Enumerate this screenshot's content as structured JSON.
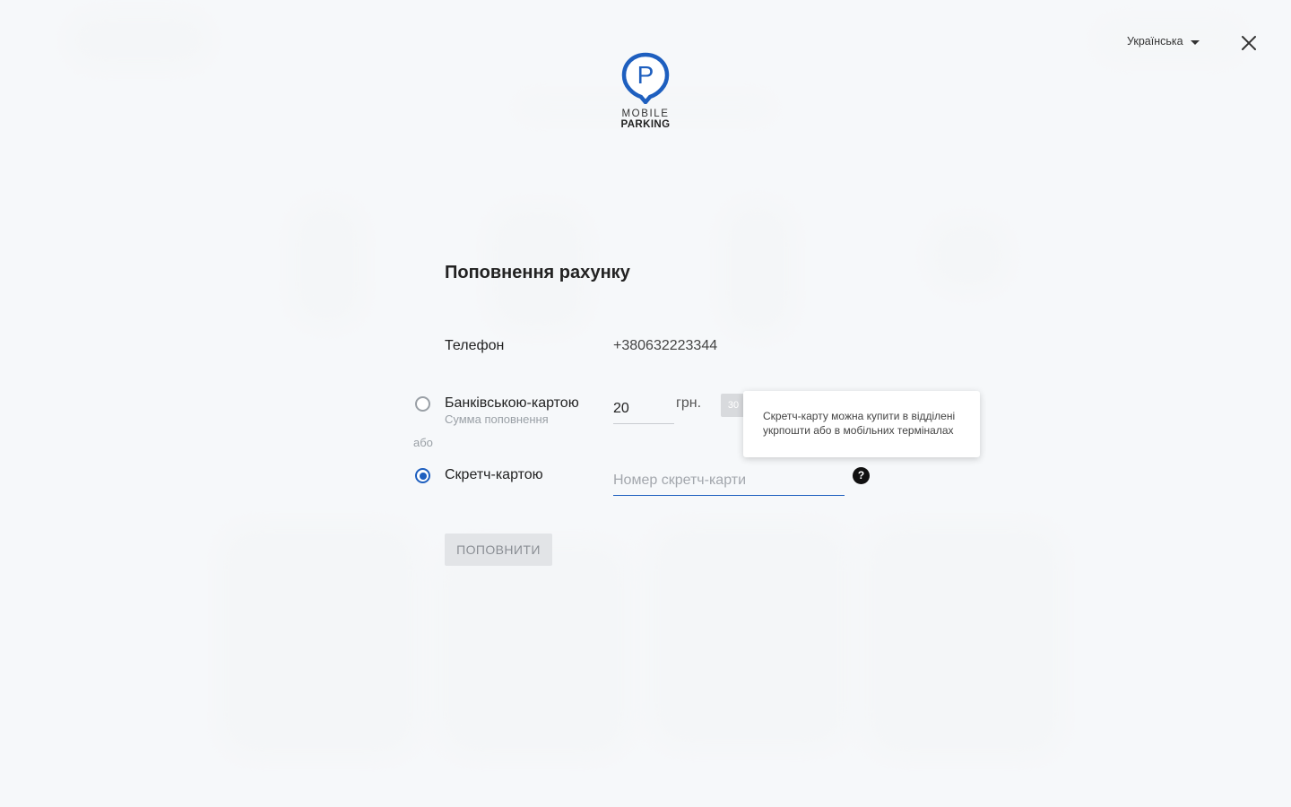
{
  "header": {
    "logo": {
      "line1": "MOBILE",
      "line2": "PARKING",
      "letter": "P"
    },
    "language": "Українська"
  },
  "form": {
    "title": "Поповнення рахунку",
    "phone_label": "Телефон",
    "phone_value": "+380632223344",
    "bank_option_label": "Банківською-картою",
    "bank_option_sub": "Сумма поповнення",
    "amount_value": "20",
    "currency": "грн.",
    "quick_amount": "30",
    "or_label": "або",
    "scratch_option_label": "Скретч-картою",
    "scratch_placeholder": "Номер скретч-карти",
    "help_symbol": "?",
    "tooltip": "Скретч-карту можна купити в відділені укрпошти або в мобільних терміналах",
    "submit_label": "ПОПОВНИТИ",
    "selected_option": "scratch"
  },
  "colors": {
    "accent": "#1e5fbf",
    "background": "#f5f7fa"
  },
  "icons": {
    "close": "close-icon",
    "caret": "chevron-down-icon",
    "help": "help-icon"
  }
}
